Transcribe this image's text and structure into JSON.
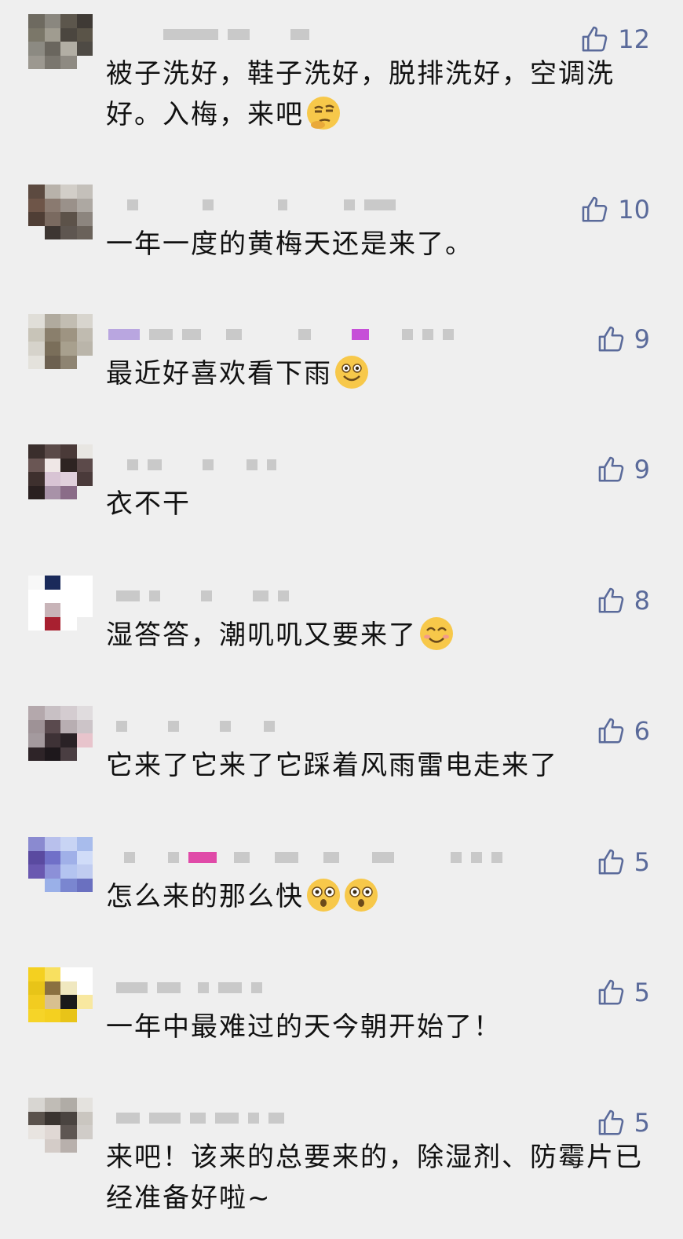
{
  "comments": [
    {
      "text": "被子洗好，鞋子洗好，脱排洗好，空调洗好。入梅，来吧",
      "likes": "12",
      "emojis": [
        "thinking-face"
      ]
    },
    {
      "text": "一年一度的黄梅天还是来了。",
      "likes": "10",
      "emojis": []
    },
    {
      "text": "最近好喜欢看下雨",
      "likes": "9",
      "emojis": [
        "grinning-face"
      ]
    },
    {
      "text": "衣不干",
      "likes": "9",
      "emojis": []
    },
    {
      "text": "湿答答，潮叽叽又要来了",
      "likes": "8",
      "emojis": [
        "smiling-face"
      ]
    },
    {
      "text": "它来了它来了它踩着风雨雷电走来了",
      "likes": "6",
      "emojis": []
    },
    {
      "text": "怎么来的那么快",
      "likes": "5",
      "emojis": [
        "astonished-face",
        "astonished-face"
      ]
    },
    {
      "text": "一年中最难过的天今朝开始了！",
      "likes": "5",
      "emojis": []
    },
    {
      "text": "来吧！该来的总要来的，除湿剂、防霉片已经准备好啦~",
      "likes": "5",
      "emojis": []
    }
  ],
  "icons": {
    "like": "thumbs-up-icon"
  },
  "colors": {
    "background": "#efefef",
    "like_color": "#5a6a9a",
    "text_color": "#111111"
  }
}
